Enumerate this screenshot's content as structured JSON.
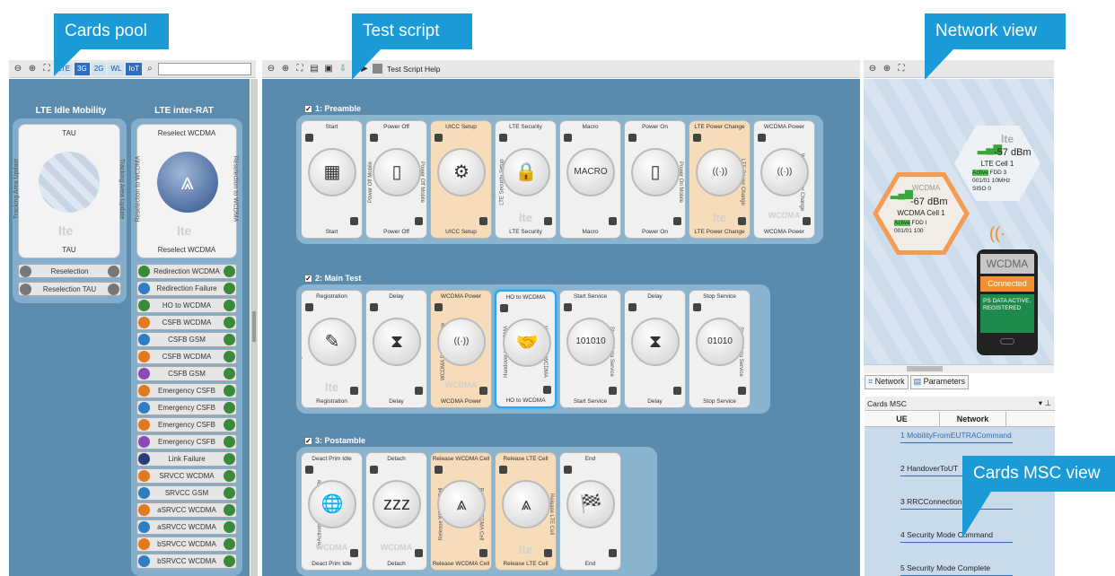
{
  "callouts": {
    "pool": "Cards pool",
    "script": "Test script",
    "network": "Network view",
    "msc": "Cards MSC view"
  },
  "pool_toolbar": {
    "filters": [
      "LTE",
      "3G",
      "2G",
      "WL",
      "IoT"
    ],
    "active_filters": [
      "3G",
      "IoT"
    ],
    "search_value": ""
  },
  "script_toolbar": {
    "help": "Test Script Help"
  },
  "pool": {
    "col1": {
      "header": "LTE Idle Mobility",
      "card": {
        "top": "TAU",
        "bottom": "TAU",
        "left": "Tracking Area Update",
        "right": "Tracking Area Update",
        "logo": "lte"
      },
      "items": [
        "Reselection",
        "Reselection TAU"
      ]
    },
    "col2": {
      "header": "LTE inter-RAT",
      "card": {
        "top": "Reselect WCDMA",
        "bottom": "Reselect WCDMA",
        "left": "Reselection to WCDMA",
        "right": "Reselection to WCDMA",
        "logo": "lte"
      },
      "items": [
        "Redirection WCDMA",
        "Redirection Failure",
        "HO to WCDMA",
        "CSFB WCDMA",
        "CSFB GSM",
        "CSFB WCDMA",
        "CSFB GSM",
        "Emergency CSFB",
        "Emergency CSFB",
        "Emergency CSFB",
        "Emergency CSFB",
        "Link Failure",
        "SRVCC WCDMA",
        "SRVCC GSM",
        "aSRVCC WCDMA",
        "aSRVCC WCDMA",
        "bSRVCC WCDMA",
        "bSRVCC WCDMA"
      ]
    }
  },
  "script": {
    "groups": [
      {
        "label": "1: Preamble",
        "checked": true,
        "cards": [
          {
            "top": "Start",
            "bottom": "Start",
            "left": "Start",
            "right": "",
            "orange": false,
            "glyph": "▦",
            "logo": ""
          },
          {
            "top": "Power Off",
            "bottom": "Power Off",
            "left": "Power Off Mobile",
            "right": "Power Off Mobile",
            "orange": false,
            "glyph": "▯",
            "logo": ""
          },
          {
            "top": "UICC Setup",
            "bottom": "UICC Setup",
            "left": "",
            "right": "UICC Setup",
            "orange": true,
            "glyph": "⚙",
            "logo": ""
          },
          {
            "top": "LTE Security",
            "bottom": "LTE Security",
            "left": "LTE Security Setup",
            "right": "",
            "orange": false,
            "glyph": "🔒",
            "logo": "lte"
          },
          {
            "top": "Macro",
            "bottom": "Macro",
            "left": "",
            "right": "Macro",
            "orange": false,
            "glyph": "MACRO",
            "logo": ""
          },
          {
            "top": "Power On",
            "bottom": "Power On",
            "left": "",
            "right": "Power On Mobile",
            "orange": false,
            "glyph": "▯",
            "logo": ""
          },
          {
            "top": "LTE Power Change",
            "bottom": "LTE Power Change",
            "left": "",
            "right": "LTE Power Change",
            "orange": true,
            "glyph": "((·))",
            "logo": "lte"
          },
          {
            "top": "WCDMA Power",
            "bottom": "WCDMA Power",
            "left": "",
            "right": "WCDMA Power Change",
            "orange": false,
            "glyph": "((·))",
            "logo": "WCDMA"
          }
        ]
      },
      {
        "label": "2: Main Test",
        "checked": true,
        "cards": [
          {
            "top": "Registration",
            "bottom": "Registration",
            "left": "Registration",
            "right": "",
            "orange": false,
            "glyph": "✎",
            "logo": "lte"
          },
          {
            "top": "Delay",
            "bottom": "Delay",
            "left": "Delay",
            "right": "",
            "orange": false,
            "glyph": "⧗",
            "logo": ""
          },
          {
            "top": "WCDMA Power",
            "bottom": "WCDMA Power",
            "left": "WCDMA Power Change",
            "right": "",
            "orange": true,
            "glyph": "((·))",
            "logo": "WCDMA"
          },
          {
            "top": "HO to WCDMA",
            "bottom": "HO to WCDMA",
            "left": "Handover to WCDMA",
            "right": "Handover to WCDMA",
            "orange": false,
            "glyph": "🤝",
            "logo": "",
            "selected": true
          },
          {
            "top": "Start Service",
            "bottom": "Start Service",
            "left": "",
            "right": "Start IP Data Service",
            "orange": false,
            "glyph": "101010",
            "logo": ""
          },
          {
            "top": "Delay",
            "bottom": "Delay",
            "left": "",
            "right": "Delay",
            "orange": false,
            "glyph": "⧗",
            "logo": ""
          },
          {
            "top": "Stop Service",
            "bottom": "Stop Service",
            "left": "",
            "right": "Stop IP Data Service",
            "orange": false,
            "glyph": "01010",
            "logo": ""
          }
        ]
      },
      {
        "label": "3: Postamble",
        "checked": true,
        "cards": [
          {
            "top": "Deact Prim Idle",
            "bottom": "Deact Prim Idle",
            "left": "DeActivate Primary PDP Idle",
            "right": "",
            "orange": false,
            "glyph": "🌐",
            "logo": "WCDMA"
          },
          {
            "top": "Detach",
            "bottom": "Detach",
            "left": "Detach Idle",
            "right": "",
            "orange": false,
            "glyph": "zzz",
            "logo": "WCDMA"
          },
          {
            "top": "Release WCDMA Cell",
            "bottom": "Release WCDMA Cell",
            "left": "Release WCDMA Cell",
            "right": "Release WCDMA Cell",
            "orange": true,
            "glyph": "⩓",
            "logo": ""
          },
          {
            "top": "Release LTE Cell",
            "bottom": "Release LTE Cell",
            "left": "",
            "right": "Release LTE Cell",
            "orange": true,
            "glyph": "⩓",
            "logo": "lte"
          },
          {
            "top": "End",
            "bottom": "End",
            "left": "",
            "right": "End",
            "orange": false,
            "glyph": "🏁",
            "logo": ""
          }
        ]
      }
    ]
  },
  "network": {
    "lte_cell": {
      "tech": "lte",
      "power": "-57 dBm",
      "name": "LTE Cell 1",
      "state": "Active",
      "band": "FDD 3",
      "mccmnc": "001/01",
      "bw": "10MHz",
      "siso": "SISO",
      "siso_val": "0"
    },
    "wcdma_cell": {
      "tech": "WCDMA",
      "power": "-67 dBm",
      "name": "WCDMA Cell 1",
      "state": "Active",
      "band": "FDD I",
      "mccmnc": "001/01",
      "val": "100"
    },
    "phone": {
      "tech": "WCDMA",
      "status": "Connected",
      "info": "PS DATA ACTIVE, REGISTERED"
    },
    "tabs": [
      "Network",
      "Parameters"
    ]
  },
  "msc": {
    "title": "Cards MSC",
    "columns": [
      "UE",
      "Network"
    ],
    "messages": [
      "1 MobilityFromEUTRACommand",
      "2 HandoverToUT",
      "3 RRCConnection",
      "4 Security Mode Command",
      "5 Security Mode Complete"
    ]
  }
}
